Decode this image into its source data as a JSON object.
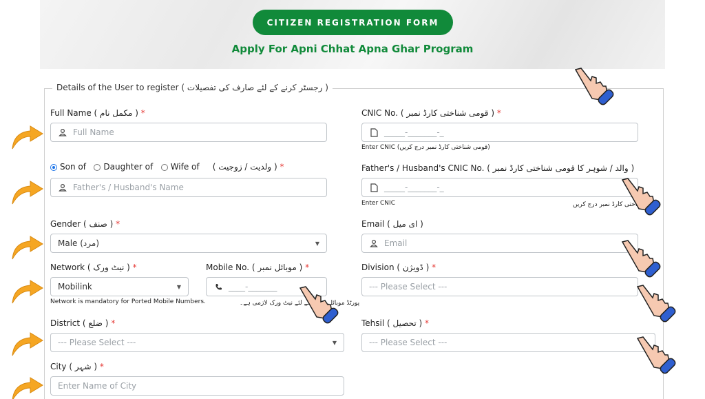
{
  "header": {
    "form_button": "CITIZEN REGISTRATION FORM",
    "subtitle": "Apply For Apni Chhat Apna Ghar Program"
  },
  "section": {
    "legend": "Details of the User to register ( رجسٹر کرنے کے لئے صارف کی تفصیلات )"
  },
  "fields": {
    "full_name": {
      "label": "Full Name ( مکمل نام )",
      "placeholder": "Full Name"
    },
    "cnic": {
      "label": "CNIC No. ( قومی شناختی کارڈ نمبر )",
      "placeholder": "_____-_______-_",
      "help": "Enter CNIC (قومی شناختی کارڈ نمبر درج کریں)"
    },
    "relation": {
      "options": [
        "Son of",
        "Daughter of",
        "Wife of"
      ],
      "selected": "Son of",
      "label": "( ولدیت / زوجیت )",
      "placeholder": "Father's / Husband's Name"
    },
    "father_cnic": {
      "label": "Father's / Husband's CNIC No. ( والد / شوہر کا قومی شناختی کارڈ نمبر )",
      "placeholder": "_____-_______-_",
      "help": "Enter CNIC",
      "help_urdu": "قومی شناختی کارڈ نمبر درج کریں"
    },
    "gender": {
      "label": "Gender ( صنف )",
      "value": "Male (مرد)"
    },
    "email": {
      "label": "Email ( ای میل )",
      "placeholder": "Email"
    },
    "network": {
      "label": "Network ( نیٹ ورک )",
      "value": "Mobilink",
      "help": "Network is mandatory for Ported Mobile Numbers.",
      "help_urdu": "پورٹڈ موبائل نمبرز کے لئے نیٹ ورک لازمی ہے۔"
    },
    "mobile": {
      "label": "Mobile No. ( موبائل نمبر )",
      "placeholder": "____-_______"
    },
    "division": {
      "label": "Division ( ڈویژن )",
      "placeholder": "--- Please Select ---"
    },
    "district": {
      "label": "District ( ضلع )",
      "placeholder": "--- Please Select ---"
    },
    "tehsil": {
      "label": "Tehsil ( تحصیل )",
      "placeholder": "--- Please Select ---"
    },
    "city": {
      "label": "City ( شہر )",
      "placeholder": "Enter Name of City"
    }
  },
  "required_mark": "*",
  "colors": {
    "brand_green": "#118a3a",
    "arrow_orange": "#f5a623",
    "hand_blue": "#2f5fd0",
    "hand_skin": "#f6c9b1"
  },
  "icons": {
    "user": "user-icon",
    "file": "file-icon",
    "phone": "phone-icon",
    "hand": "pointing-hand-icon",
    "arrow": "curved-arrow-icon"
  }
}
